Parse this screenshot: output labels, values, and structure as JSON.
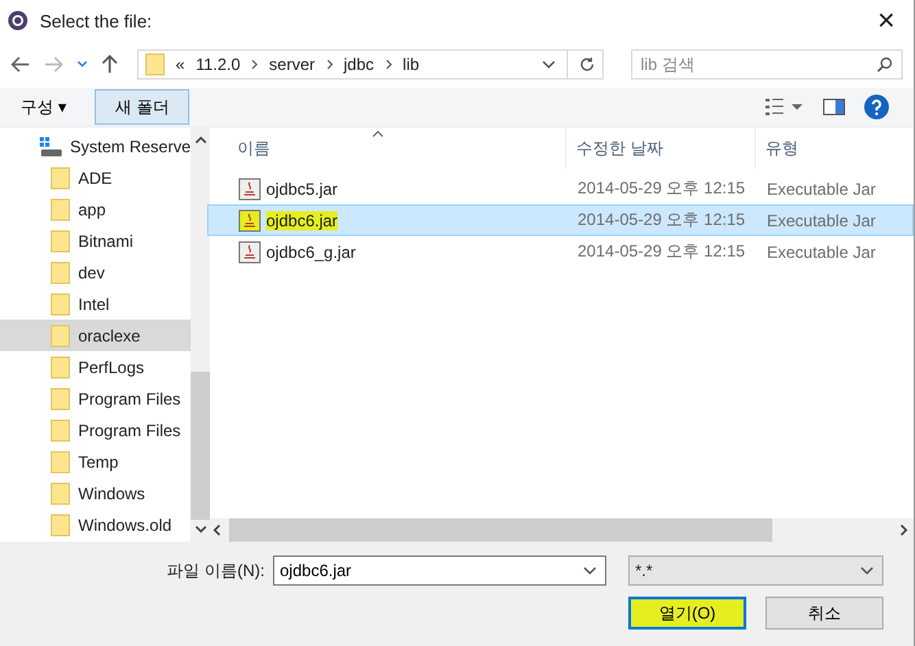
{
  "window": {
    "title": "Select the file:",
    "close": "×"
  },
  "address": {
    "prefix": "«",
    "crumbs": [
      "11.2.0",
      "server",
      "jdbc",
      "lib"
    ],
    "search_placeholder": "lib 검색"
  },
  "toolbar": {
    "organize": "구성 ▾",
    "new_folder": "새 폴더"
  },
  "sidebar": {
    "items": [
      {
        "name": "System Reserve",
        "kind": "drive",
        "selected": false
      },
      {
        "name": "ADE",
        "kind": "folder",
        "selected": false
      },
      {
        "name": "app",
        "kind": "folder",
        "selected": false
      },
      {
        "name": "Bitnami",
        "kind": "folder",
        "selected": false
      },
      {
        "name": "dev",
        "kind": "folder",
        "selected": false
      },
      {
        "name": "Intel",
        "kind": "folder",
        "selected": false
      },
      {
        "name": "oraclexe",
        "kind": "folder",
        "selected": true
      },
      {
        "name": "PerfLogs",
        "kind": "folder",
        "selected": false
      },
      {
        "name": "Program Files",
        "kind": "folder",
        "selected": false
      },
      {
        "name": "Program Files",
        "kind": "folder",
        "selected": false
      },
      {
        "name": "Temp",
        "kind": "folder",
        "selected": false
      },
      {
        "name": "Windows",
        "kind": "folder",
        "selected": false
      },
      {
        "name": "Windows.old",
        "kind": "folder",
        "selected": false
      }
    ]
  },
  "table": {
    "columns": [
      "이름",
      "수정한 날짜",
      "유형"
    ],
    "rows": [
      {
        "name": "ojdbc5.jar",
        "date": "2014-05-29 오후 12:15",
        "type": "Executable Jar",
        "selected": false,
        "highlighted": false
      },
      {
        "name": "ojdbc6.jar",
        "date": "2014-05-29 오후 12:15",
        "type": "Executable Jar",
        "selected": true,
        "highlighted": true
      },
      {
        "name": "ojdbc6_g.jar",
        "date": "2014-05-29 오후 12:15",
        "type": "Executable Jar",
        "selected": false,
        "highlighted": false
      }
    ]
  },
  "footer": {
    "filename_label": "파일 이름(N):",
    "filename_value": "ojdbc6.jar",
    "filter": "*.*",
    "buttons": [
      {
        "label": "열기(O)",
        "highlighted": true,
        "selected": true
      },
      {
        "label": "취소",
        "highlighted": false,
        "selected": false
      }
    ]
  }
}
